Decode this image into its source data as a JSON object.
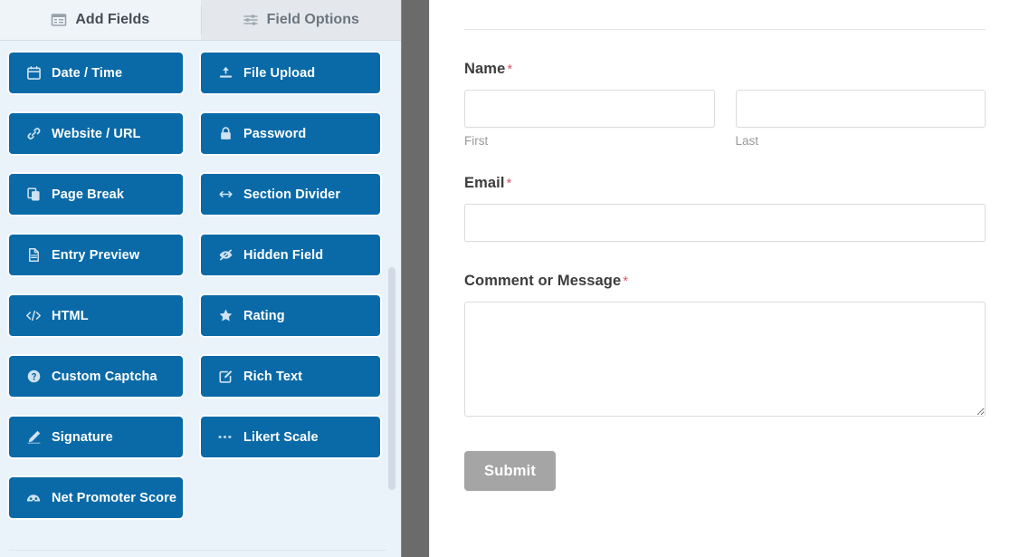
{
  "builder": {
    "tabs": [
      {
        "label": "Add Fields",
        "icon": "panel-list-icon",
        "active": true
      },
      {
        "label": "Field Options",
        "icon": "sliders-icon",
        "active": false
      }
    ],
    "accent_color": "#0a6aa8",
    "panel_background": "#eaf2fa",
    "divider_color": "#6b6b6b",
    "fields": [
      {
        "label": "Date / Time",
        "icon": "calendar-icon"
      },
      {
        "label": "File Upload",
        "icon": "upload-icon"
      },
      {
        "label": "Website / URL",
        "icon": "link-icon"
      },
      {
        "label": "Password",
        "icon": "lock-icon"
      },
      {
        "label": "Page Break",
        "icon": "page-break-icon"
      },
      {
        "label": "Section Divider",
        "icon": "arrows-horizontal-icon"
      },
      {
        "label": "Entry Preview",
        "icon": "document-icon"
      },
      {
        "label": "Hidden Field",
        "icon": "eye-slash-icon"
      },
      {
        "label": "HTML",
        "icon": "code-icon"
      },
      {
        "label": "Rating",
        "icon": "star-icon"
      },
      {
        "label": "Custom Captcha",
        "icon": "question-circle-icon"
      },
      {
        "label": "Rich Text",
        "icon": "edit-square-icon"
      },
      {
        "label": "Signature",
        "icon": "pencil-icon"
      },
      {
        "label": "Likert Scale",
        "icon": "likert-icon"
      },
      {
        "label": "Net Promoter Score",
        "icon": "gauge-icon"
      }
    ]
  },
  "preview": {
    "required_marker": "*",
    "required_color": "#d9596c",
    "name_field": {
      "label": "Name",
      "required": true,
      "first": {
        "value": "",
        "sub_label": "First"
      },
      "last": {
        "value": "",
        "sub_label": "Last"
      }
    },
    "email_field": {
      "label": "Email",
      "required": true,
      "value": ""
    },
    "comment_field": {
      "label": "Comment or Message",
      "required": true,
      "value": ""
    },
    "submit": {
      "label": "Submit",
      "color": "#a5a5a5"
    }
  }
}
